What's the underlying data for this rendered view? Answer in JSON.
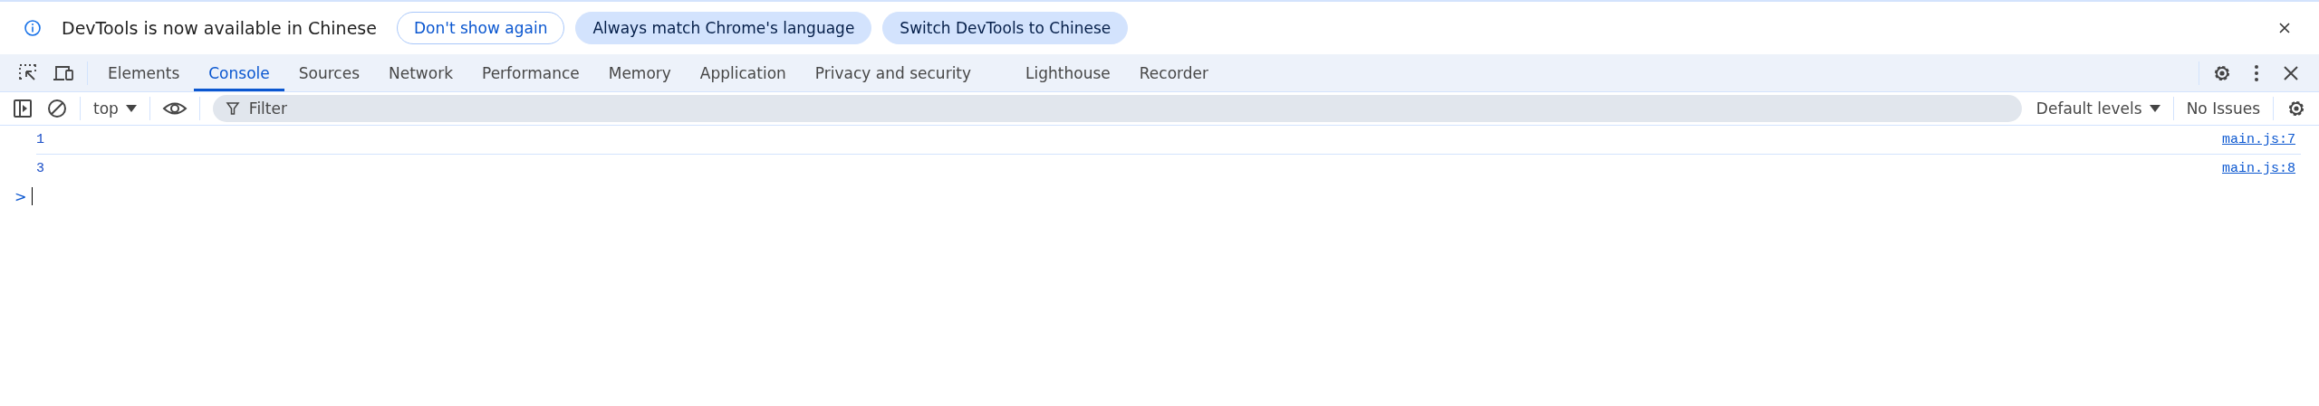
{
  "infobar": {
    "message": "DevTools is now available in Chinese",
    "buttons": [
      {
        "label": "Don't show again",
        "kind": "outline"
      },
      {
        "label": "Always match Chrome's language",
        "kind": "tonal"
      },
      {
        "label": "Switch DevTools to Chinese",
        "kind": "tonal"
      }
    ]
  },
  "tabs": [
    {
      "label": "Elements",
      "selected": false
    },
    {
      "label": "Console",
      "selected": true
    },
    {
      "label": "Sources",
      "selected": false
    },
    {
      "label": "Network",
      "selected": false
    },
    {
      "label": "Performance",
      "selected": false
    },
    {
      "label": "Memory",
      "selected": false
    },
    {
      "label": "Application",
      "selected": false
    },
    {
      "label": "Privacy and security",
      "selected": false
    },
    {
      "label": "Lighthouse",
      "selected": false
    },
    {
      "label": "Recorder",
      "selected": false
    }
  ],
  "console_toolbar": {
    "context": "top",
    "filter_placeholder": "Filter",
    "levels": "Default levels",
    "issues": "No Issues"
  },
  "messages": [
    {
      "value": "1",
      "source": "main.js:7"
    },
    {
      "value": "3",
      "source": "main.js:8"
    }
  ],
  "prompt": ">"
}
